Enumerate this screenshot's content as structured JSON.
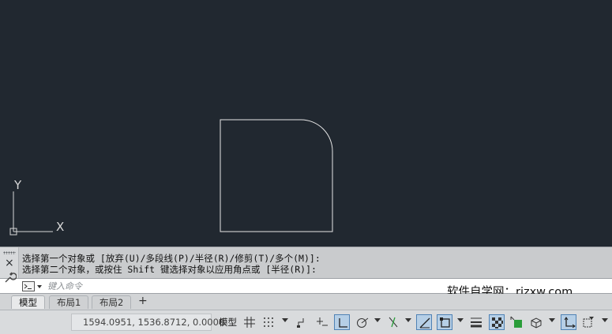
{
  "ucs": {
    "y_label": "Y",
    "x_label": "X"
  },
  "command_line": {
    "close_glyph": "×",
    "history_line1": "选择第一个对象或 [放弃(U)/多段线(P)/半径(R)/修剪(T)/多个(M)]:",
    "history_line2": "选择第二个对象，或按住 Shift 键选择对象以应用角点或 [半径(R)]:",
    "input_placeholder": "键入命令",
    "input_value": ""
  },
  "watermark": "软件自学网：rjzxw.com",
  "layout_tabs": [
    {
      "label": "模型",
      "active": true
    },
    {
      "label": "布局1",
      "active": false
    },
    {
      "label": "布局2",
      "active": false
    }
  ],
  "add_tab_glyph": "+",
  "status_bar": {
    "coordinates": "1594.0951, 1536.8712, 0.0000",
    "model_label": "模型",
    "icons": [
      "grid-icon",
      "snap-mode-icon",
      "infer-constraints-icon",
      "dynamic-input-icon",
      "ortho-mode-icon",
      "polar-tracking-icon",
      "isometric-drafting-icon",
      "object-snap-tracking-icon",
      "object-snap-icon",
      "lineweight-icon",
      "transparency-icon",
      "selection-cycling-icon",
      "3d-object-snap-icon",
      "dynamic-ucs-icon",
      "selection-filter-icon"
    ]
  },
  "colors": {
    "canvas_bg": "#212830",
    "drawing_line": "#e6e6e6",
    "command_bg": "#c9cbcd",
    "status_bg": "#d9dbdd",
    "active_icon_bg": "#b6cfe6"
  }
}
